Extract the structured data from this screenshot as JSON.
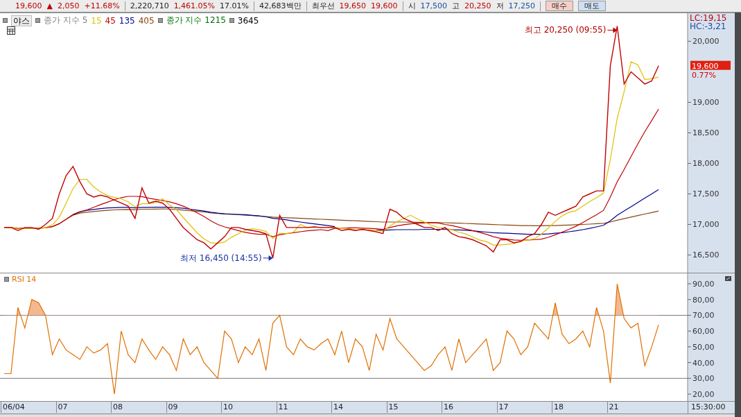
{
  "ticker_strip": [
    {
      "text": "19,600",
      "kind": "up"
    },
    {
      "text": "▲",
      "kind": "up"
    },
    {
      "text": "2,050",
      "kind": "up"
    },
    {
      "text": "+11.68%",
      "kind": "up"
    },
    {
      "text": "2,220,710",
      "kind": "plain"
    },
    {
      "text": "1,461.05%",
      "kind": "up"
    },
    {
      "text": "17.01%",
      "kind": "plain"
    },
    {
      "text": "42,683백만",
      "kind": "plain"
    },
    {
      "text": "최우선",
      "kind": "plain"
    },
    {
      "text": "19,650",
      "kind": "up"
    },
    {
      "text": "19,600",
      "kind": "up"
    },
    {
      "text": "시",
      "kind": "plain"
    },
    {
      "text": "17,500",
      "kind": "down"
    },
    {
      "text": "고",
      "kind": "plain"
    },
    {
      "text": "20,250",
      "kind": "up"
    },
    {
      "text": "저",
      "kind": "plain"
    },
    {
      "text": "17,250",
      "kind": "down"
    },
    {
      "text": "매수",
      "kind": "buy"
    },
    {
      "text": "매도",
      "kind": "sell"
    }
  ],
  "price_panel": {
    "legend": [
      {
        "text": "야스",
        "kind": "toggle"
      },
      {
        "text": "종가 지수 5",
        "kind": "label",
        "color": "#808080"
      },
      {
        "text": "종가 지수 1215",
        "kind": "label",
        "color": "#007000"
      },
      {
        "text": "3645",
        "kind": "label",
        "color": "#000000"
      }
    ],
    "lc_label": "LC:19,15",
    "hc_label": "HC:-3,21",
    "current_price": "19,600",
    "change": "0.77%",
    "chart_data": {
      "type": "line",
      "ylim": [
        16210,
        20460
      ],
      "yticks": [
        {
          "value": 16500,
          "label": "16,500"
        },
        {
          "value": 17000,
          "label": "17,000"
        },
        {
          "value": 17500,
          "label": "17,500"
        },
        {
          "value": 18000,
          "label": "18,000"
        },
        {
          "value": 18500,
          "label": "18,500"
        },
        {
          "value": 19000,
          "label": "19,000"
        },
        {
          "value": 20000,
          "label": "20,000"
        }
      ],
      "series": [
        {
          "color": "#c00000",
          "values": [
            16950,
            16950,
            16900,
            16950,
            16950,
            16920,
            17000,
            17100,
            17500,
            17800,
            17950,
            17700,
            17500,
            17450,
            17480,
            17450,
            17400,
            17350,
            17300,
            17100,
            17600,
            17350,
            17380,
            17350,
            17250,
            17100,
            16950,
            16850,
            16750,
            16700,
            16600,
            16700,
            16800,
            16950,
            16950,
            16920,
            16900,
            16880,
            16850,
            16450,
            17150,
            16950,
            16950,
            16950,
            16950,
            16960,
            16950,
            16950,
            16950,
            16900,
            16920,
            16900,
            16920,
            16900,
            16880,
            16850,
            17250,
            17200,
            17100,
            17050,
            17000,
            16950,
            16950,
            16900,
            16950,
            16850,
            16800,
            16780,
            16750,
            16700,
            16650,
            16550,
            16750,
            16750,
            16700,
            16720,
            16800,
            16850,
            17000,
            17200,
            17150,
            17200,
            17250,
            17300,
            17450,
            17500,
            17550,
            17550,
            19600,
            20250,
            19300,
            19500,
            19400,
            19300,
            19350,
            19600
          ]
        },
        {
          "name": "15",
          "color": "#e0c000",
          "values": [
            16950,
            16950,
            16925,
            16938,
            16938,
            16930,
            16948,
            16993,
            17118,
            17350,
            17588,
            17738,
            17738,
            17613,
            17533,
            17470,
            17445,
            17420,
            17370,
            17288,
            17338,
            17338,
            17358,
            17420,
            17320,
            17245,
            17113,
            16988,
            16863,
            16763,
            16700,
            16688,
            16713,
            16788,
            16850,
            16905,
            16930,
            16913,
            16888,
            16770,
            16858,
            16848,
            16875,
            17000,
            16950,
            16953,
            16953,
            16953,
            16953,
            16938,
            16933,
            16910,
            16910,
            16910,
            16905,
            16888,
            16975,
            17045,
            17100,
            17150,
            17088,
            17038,
            16988,
            16950,
            16938,
            16913,
            16875,
            16845,
            16795,
            16745,
            16720,
            16663,
            16663,
            16675,
            16688,
            16730,
            16743,
            16768,
            16843,
            16943,
            17050,
            17138,
            17200,
            17225,
            17300,
            17375,
            17438,
            17513,
            18063,
            18738,
            19175,
            19663,
            19613,
            19375,
            19388,
            19413
          ]
        },
        {
          "name": "45",
          "color": "#c00000",
          "values": [
            16950,
            16950,
            16933,
            16938,
            16940,
            16937,
            16946,
            16964,
            17012,
            17085,
            17165,
            17210,
            17238,
            17280,
            17325,
            17365,
            17405,
            17440,
            17460,
            17460,
            17455,
            17430,
            17410,
            17390,
            17370,
            17340,
            17300,
            17250,
            17190,
            17130,
            17060,
            17000,
            16960,
            16930,
            16900,
            16870,
            16850,
            16840,
            16840,
            16800,
            16830,
            16850,
            16865,
            16880,
            16895,
            16905,
            16915,
            16900,
            16935,
            16940,
            16945,
            16945,
            16940,
            16935,
            16930,
            16920,
            16950,
            16975,
            16995,
            17010,
            17020,
            17025,
            17030,
            17025,
            17000,
            16980,
            16955,
            16925,
            16900,
            16870,
            16840,
            16800,
            16775,
            16760,
            16745,
            16740,
            16745,
            16750,
            16760,
            16790,
            16830,
            16875,
            16920,
            16970,
            17030,
            17095,
            17160,
            17230,
            17450,
            17700,
            17900,
            18110,
            18320,
            18520,
            18700,
            18890
          ]
        },
        {
          "name": "135",
          "color": "#000090",
          "values": [
            null,
            null,
            null,
            null,
            null,
            null,
            null,
            null,
            null,
            null,
            17160,
            17205,
            17230,
            17245,
            17260,
            17270,
            17275,
            17280,
            17280,
            17270,
            17280,
            17280,
            17282,
            17283,
            17280,
            17275,
            17265,
            17250,
            17235,
            17220,
            17200,
            17185,
            17175,
            17170,
            17165,
            17160,
            17150,
            17140,
            17125,
            17100,
            17090,
            17075,
            17055,
            17040,
            17025,
            17010,
            16995,
            16980,
            16965,
            null,
            null,
            null,
            null,
            null,
            16910,
            16905,
            16910,
            16915,
            16915,
            16915,
            16915,
            16920,
            16920,
            16920,
            16920,
            16915,
            16910,
            16905,
            16895,
            16885,
            16875,
            16865,
            16860,
            16855,
            16850,
            16845,
            16840,
            16838,
            16840,
            16845,
            16855,
            16865,
            16880,
            16895,
            16915,
            16935,
            16960,
            16985,
            17060,
            17150,
            17220,
            17290,
            17360,
            17430,
            17500,
            17570
          ]
        },
        {
          "name": "405",
          "color": "#8b4513",
          "values": [
            16950,
            16950,
            16933,
            16938,
            16940,
            16937,
            16946,
            16964,
            17012,
            17085,
            17150,
            17185,
            17200,
            17212,
            17222,
            17230,
            17238,
            17243,
            17245,
            17240,
            17250,
            17250,
            17252,
            17255,
            17250,
            17245,
            17235,
            17225,
            17215,
            17205,
            17190,
            17180,
            17172,
            17165,
            17160,
            17152,
            17145,
            17138,
            17130,
            17120,
            17115,
            17110,
            17105,
            17100,
            17095,
            17090,
            17085,
            17080,
            17075,
            17070,
            17065,
            17060,
            17055,
            17050,
            17045,
            17040,
            17040,
            17040,
            17040,
            17038,
            17036,
            17034,
            17032,
            17030,
            17028,
            17025,
            17020,
            17017,
            17013,
            17008,
            17003,
            16998,
            16994,
            16990,
            16986,
            16982,
            16980,
            16978,
            16978,
            16980,
            16982,
            16986,
            16990,
            16995,
            17000,
            17006,
            17012,
            17018,
            17040,
            17070,
            17095,
            17120,
            17145,
            17170,
            17195,
            17220
          ]
        }
      ],
      "annotations": [
        "최고 20,250 (09:55)",
        "최저 16,450 (14:55)"
      ]
    }
  },
  "rsi_panel": {
    "chart_data": {
      "type": "line",
      "ylim": [
        15.6,
        96.6
      ],
      "yticks": [
        {
          "value": 20,
          "label": "20,00"
        },
        {
          "value": 30,
          "label": "30,00"
        },
        {
          "value": 40,
          "label": "40,00"
        },
        {
          "value": 50,
          "label": "50,00"
        },
        {
          "value": 60,
          "label": "60,00"
        },
        {
          "value": 70,
          "label": "70,00"
        },
        {
          "value": 80,
          "label": "80,00"
        },
        {
          "value": 90,
          "label": "90,00"
        }
      ],
      "series": [
        {
          "name": "RSI 14",
          "color": "#e07000",
          "values": [
            33,
            33,
            75,
            62,
            80,
            78,
            70,
            45,
            55,
            48,
            45,
            42,
            50,
            46,
            48,
            52,
            20,
            60,
            45,
            40,
            55,
            48,
            42,
            50,
            45,
            35,
            55,
            45,
            50,
            40,
            35,
            30,
            60,
            55,
            40,
            50,
            45,
            55,
            35,
            65,
            70,
            50,
            45,
            55,
            50,
            48,
            52,
            55,
            45,
            60,
            40,
            55,
            50,
            35,
            58,
            48,
            68,
            55,
            50,
            45,
            40,
            35,
            38,
            45,
            50,
            35,
            55,
            40,
            45,
            50,
            55,
            35,
            40,
            60,
            55,
            45,
            50,
            65,
            60,
            55,
            78,
            58,
            52,
            55,
            60,
            50,
            75,
            60,
            27,
            90,
            68,
            62,
            65,
            38,
            50,
            64
          ]
        }
      ],
      "ref_lines": [
        {
          "axis": "y",
          "value": 70
        },
        {
          "axis": "y",
          "value": 30
        }
      ]
    }
  },
  "date_labels": [
    "06/04",
    "07",
    "08",
    "09",
    "10",
    "11",
    "14",
    "15",
    "16",
    "17",
    "18",
    "21"
  ],
  "time_label": "15:30:00"
}
